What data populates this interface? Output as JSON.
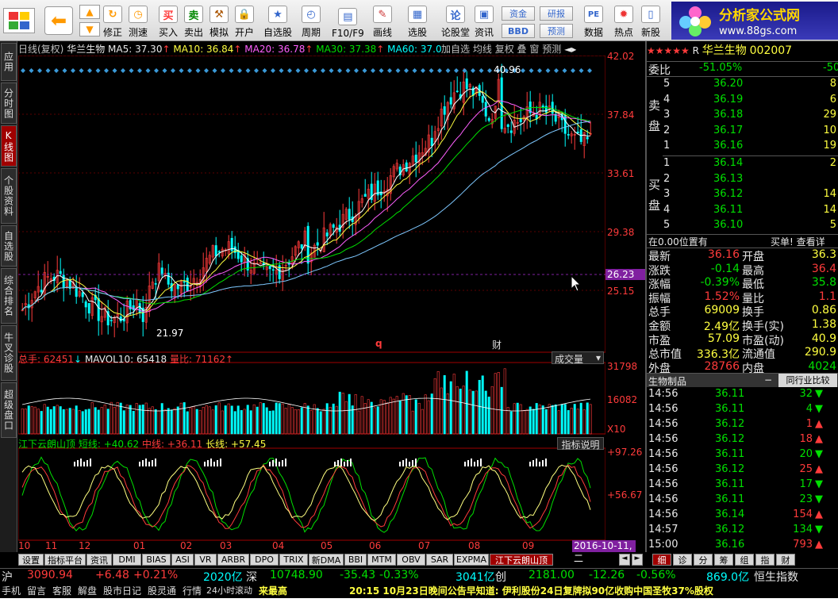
{
  "toolbar": {
    "buttons": [
      "买入",
      "卖出",
      "模拟",
      "开户",
      "自选股",
      "周期",
      "F10/F9",
      "画线",
      "选股",
      "论股堂",
      "资讯",
      "数据",
      "热点",
      "新股",
      "沪"
    ],
    "left_buttons": [
      "修正",
      "测速"
    ],
    "small": [
      "资金",
      "研报",
      "BBD",
      "预测"
    ],
    "logo_title": "分析家公式网",
    "logo_url": "www.88gs.com"
  },
  "left_tabs": [
    "应用",
    "分时图",
    "K线图",
    "个股资料",
    "自选股",
    "综合排名",
    "牛叉诊股",
    "超级盘口"
  ],
  "kline_header": {
    "period": "日线(复权)",
    "stock": "华兰生物",
    "ma5": "MA5: 37.30",
    "ma10": "MA10: 36.84",
    "ma20": "MA20: 36.78",
    "ma30": "MA30: 37.38",
    "ma60": "MA60: 37.02",
    "menu": [
      "加自选",
      "均线",
      "复权",
      "叠",
      "窗",
      "预测"
    ]
  },
  "price_axis": [
    "42.02",
    "37.84",
    "33.61",
    "29.38",
    "26.23",
    "25.15"
  ],
  "price_marks": {
    "high": "40.96",
    "low": "21.97",
    "q": "q",
    "cai": "财"
  },
  "vol_header": {
    "total": "总手: 62451",
    "mavol": "MAVOL10: 65418",
    "ratio": "量比: 71162",
    "dropdown": "成交量"
  },
  "vol_axis": [
    "31798",
    "16082",
    "X10"
  ],
  "ind_header": {
    "name": "江下云朗山顶",
    "short": "短线: +40.62",
    "mid": "中线: +36.11",
    "long": "长线: +57.45",
    "btn": "指标说明"
  },
  "ind_axis": [
    "+97.26",
    "+56.67"
  ],
  "months": [
    "10",
    "11",
    "12",
    "01",
    "02",
    "03",
    "04",
    "05",
    "06",
    "07",
    "08",
    "09"
  ],
  "date_label": "2016-10-11,二",
  "bottom_tabs": [
    "设置",
    "指标平台",
    "资讯",
    "DMI",
    "BIAS",
    "ASI",
    "VR",
    "ARBR",
    "DPO",
    "TRIX",
    "新DMA",
    "BBI",
    "MTM",
    "OBV",
    "SAR",
    "EXPMA",
    "江下云朗山顶"
  ],
  "right_tabs": [
    "细",
    "诊",
    "分",
    "筹",
    "组",
    "指",
    "财"
  ],
  "quote": {
    "stars": "★★★★★",
    "flag": "R",
    "name": "华兰生物",
    "code": "002007",
    "weibi_label": "委比",
    "weibi": "-51.05%",
    "weicha": "-50",
    "sell_label": "卖盘",
    "buy_label": "买盘",
    "sell": [
      {
        "n": "5",
        "p": "36.20",
        "v": "8"
      },
      {
        "n": "4",
        "p": "36.19",
        "v": "6"
      },
      {
        "n": "3",
        "p": "36.18",
        "v": "29"
      },
      {
        "n": "2",
        "p": "36.17",
        "v": "10"
      },
      {
        "n": "1",
        "p": "36.16",
        "v": "19"
      }
    ],
    "buy": [
      {
        "n": "1",
        "p": "36.14",
        "v": "2"
      },
      {
        "n": "2",
        "p": "36.13",
        "v": ""
      },
      {
        "n": "3",
        "p": "36.12",
        "v": "14"
      },
      {
        "n": "4",
        "p": "36.11",
        "v": "14"
      },
      {
        "n": "5",
        "p": "36.10",
        "v": "5"
      }
    ],
    "pos_text": "在0.00位置有",
    "pos_right": "买单! 查看详",
    "stats": [
      {
        "l": "最新",
        "v": "36.16",
        "l2": "开盘",
        "v2": "36.3"
      },
      {
        "l": "涨跌",
        "v": "-0.14",
        "l2": "最高",
        "v2": "36.4"
      },
      {
        "l": "涨幅",
        "v": "-0.39%",
        "l2": "最低",
        "v2": "35.8"
      },
      {
        "l": "振幅",
        "v": "1.52%",
        "l2": "量比",
        "v2": "1.1"
      },
      {
        "l": "总手",
        "v": "69009",
        "l2": "换手",
        "v2": "0.86"
      },
      {
        "l": "金额",
        "v": "2.49亿",
        "l2": "换手(实)",
        "v2": "1.38"
      },
      {
        "l": "市盈",
        "v": "57.09",
        "l2": "市盈(动)",
        "v2": "40.9"
      },
      {
        "l": "总市值",
        "v": "336.3亿",
        "l2": "流通值",
        "v2": "290.9"
      },
      {
        "l": "外盘",
        "v": "28766",
        "l2": "内盘",
        "v2": "4024"
      }
    ],
    "industry": "生物制品",
    "industry_btn": "同行业比较",
    "ticks": [
      {
        "t": "14:56",
        "p": "36.11",
        "v": "32",
        "d": "down"
      },
      {
        "t": "14:56",
        "p": "36.11",
        "v": "4",
        "d": "down"
      },
      {
        "t": "14:56",
        "p": "36.12",
        "v": "1",
        "d": "up"
      },
      {
        "t": "14:56",
        "p": "36.12",
        "v": "18",
        "d": "up"
      },
      {
        "t": "14:56",
        "p": "36.11",
        "v": "20",
        "d": "down"
      },
      {
        "t": "14:56",
        "p": "36.12",
        "v": "25",
        "d": "up"
      },
      {
        "t": "14:56",
        "p": "36.11",
        "v": "17",
        "d": "down"
      },
      {
        "t": "14:56",
        "p": "36.11",
        "v": "23",
        "d": "down"
      },
      {
        "t": "14:56",
        "p": "36.14",
        "v": "154",
        "d": "up"
      },
      {
        "t": "14:57",
        "p": "36.12",
        "v": "134",
        "d": "down"
      },
      {
        "t": "15:00",
        "p": "36.16",
        "v": "793",
        "d": "up"
      }
    ]
  },
  "status": {
    "sh_label": "沪",
    "sh_idx": "3090.94",
    "sh_chg": "+6.48",
    "sh_pct": "+0.21%",
    "sh_amt": "2020亿",
    "sz_label": "深",
    "sz_idx": "10748.90",
    "sz_chg": "-35.43",
    "sz_pct": "-0.33%",
    "sz_amt": "3041亿",
    "cy_label": "创",
    "cy_idx": "2181.00",
    "cy_chg": "-12.26",
    "cy_pct": "-0.56%",
    "cy_amt": "869.0亿",
    "hs_label": "恒生指数"
  },
  "footer": {
    "items": [
      "手机",
      "留言",
      "客服",
      "解盘",
      "股市日记",
      "股灵通",
      "行情",
      "24小时滚动"
    ],
    "highlight": "来最高",
    "news": "20:15 10月23日晚间公告早知道: 伊利股份24日复牌拟90亿收购中国圣牧37%股权"
  },
  "colors": {
    "up": "#ff3b3b",
    "down": "#00e000",
    "ma5": "#ffffff",
    "ma10": "#ffff40",
    "ma20": "#ff60ff",
    "ma30": "#00e000",
    "ma60": "#7ec8ff"
  }
}
